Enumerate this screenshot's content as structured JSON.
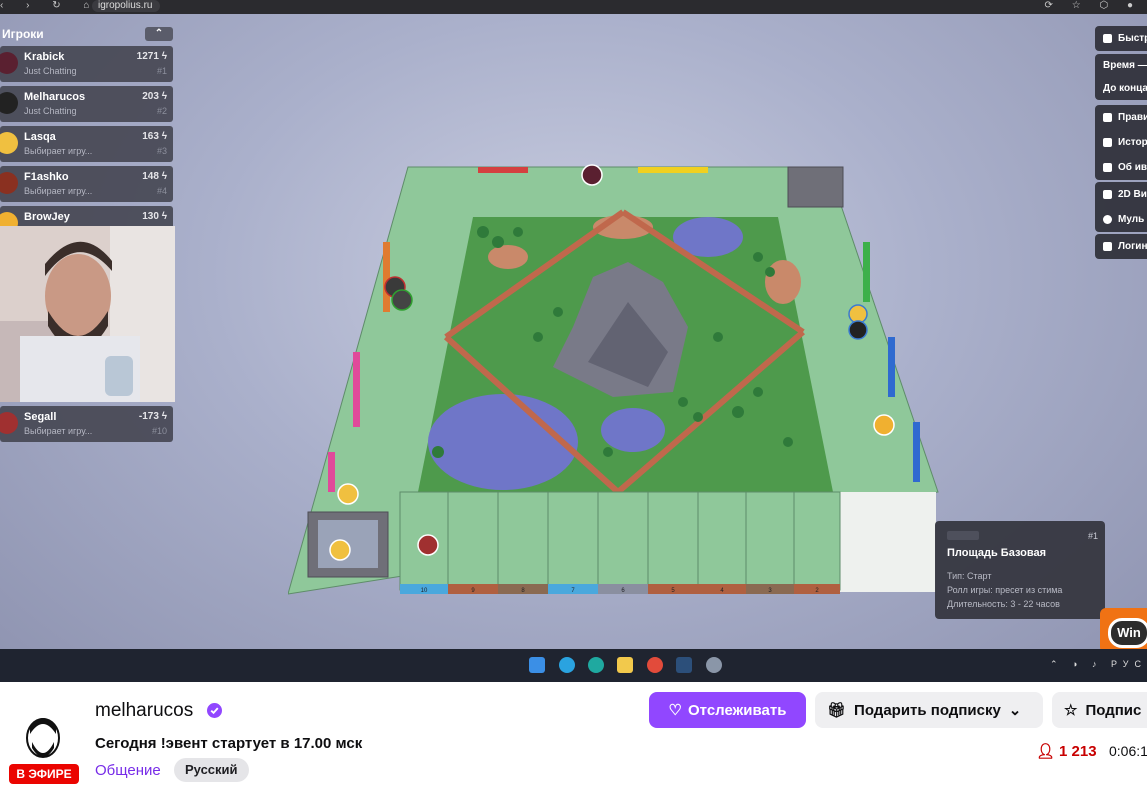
{
  "browser": {
    "url": "igropolius.ru"
  },
  "players_panel": {
    "title": "Игроки",
    "players": [
      {
        "name": "Krabick",
        "status": "Just Chatting",
        "score": "1271",
        "rank": "#1",
        "color": "#5a2030"
      },
      {
        "name": "Melharucos",
        "status": "Just Chatting",
        "score": "203",
        "rank": "#2",
        "color": "#222222"
      },
      {
        "name": "Lasqa",
        "status": "Выбирает игру...",
        "score": "163",
        "rank": "#3",
        "color": "#f0c040"
      },
      {
        "name": "F1ashko",
        "status": "Выбирает игру...",
        "score": "148",
        "rank": "#4",
        "color": "#8a3020"
      },
      {
        "name": "BrowJey",
        "status": "",
        "score": "130",
        "rank": "",
        "color": "#f0b030"
      },
      {
        "name": "Segall",
        "status": "Выбирает игру...",
        "score": "-173",
        "rank": "#10",
        "color": "#a03030"
      }
    ]
  },
  "right_menu": {
    "group1": [
      "Быстр"
    ],
    "group2": [
      "Время —",
      "До конца"
    ],
    "group3": [
      "Прави",
      "Истор",
      "Об ив"
    ],
    "group4": [
      "2D Ви",
      "Муль"
    ],
    "group5": [
      "Логин"
    ]
  },
  "board": {
    "bottom_numbers": [
      "10",
      "9",
      "8",
      "7",
      "6",
      "5",
      "4",
      "3",
      "2"
    ]
  },
  "tooltip": {
    "number": "#1",
    "title": "Площадь Базовая",
    "type_line": "Тип: Старт",
    "roll_line": "Ролл игры: пресет из стима",
    "duration_line": "Длительность: 3 - 22 часов"
  },
  "win_badge": "Win",
  "taskbar": {
    "tray_lang": "РУС"
  },
  "channel": {
    "name": "melharucos",
    "live_label": "В ЭФИРЕ",
    "stream_title": "Сегодня !эвент стартует в 17.00 мск",
    "category": "Общение",
    "language_tag": "Русский",
    "viewers": "1 213",
    "uptime": "0:06:1"
  },
  "actions": {
    "follow_label": "Отслеживать",
    "gift_label": "Подарить подписку",
    "subscribe_label": "Подпис"
  },
  "colors": {
    "twitch_purple": "#9147ff",
    "live_red": "#eb0400",
    "viewer_red": "#c80000",
    "board_green": "#8fc89a",
    "tooltip_bg": "#373842"
  }
}
